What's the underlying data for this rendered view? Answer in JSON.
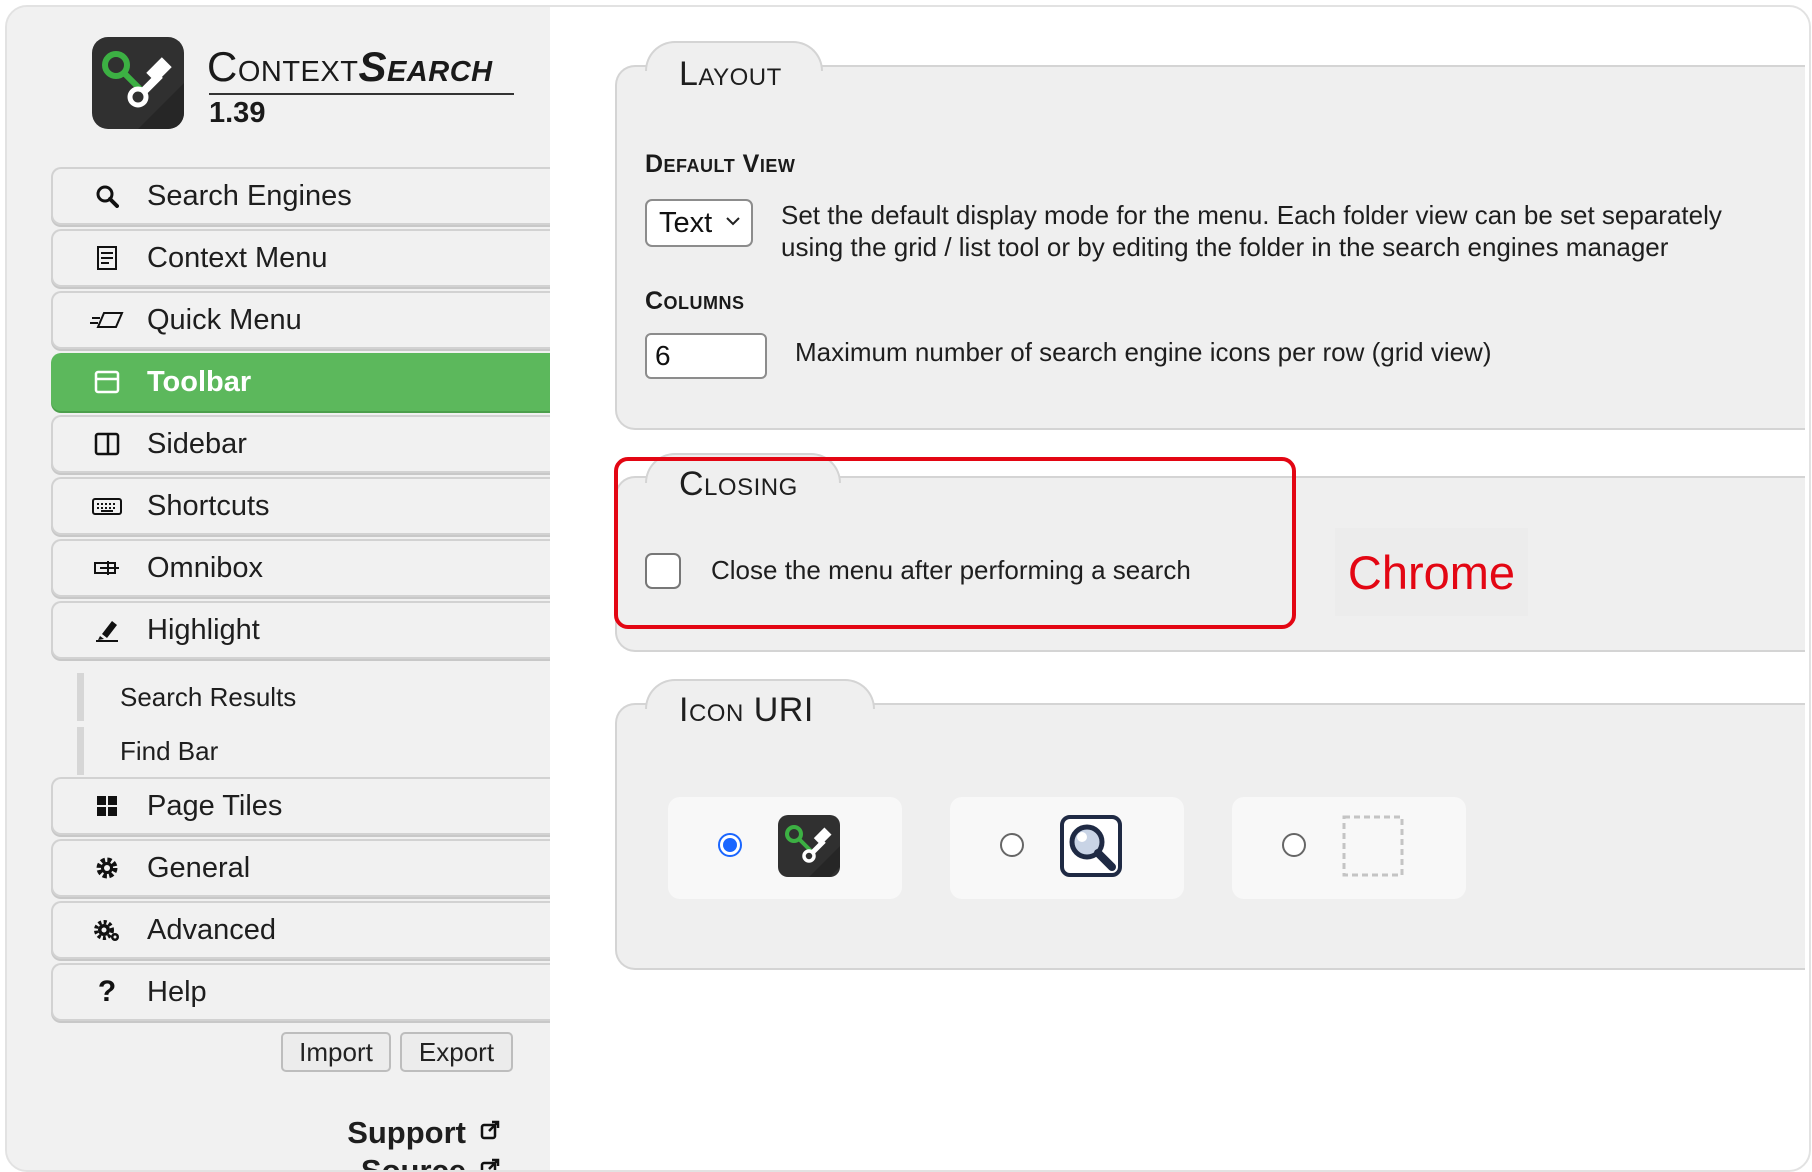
{
  "app": {
    "name_part1": "Context",
    "name_part2": "Search",
    "version": "1.39"
  },
  "nav": {
    "items": [
      {
        "label": "Search Engines",
        "icon": "search-icon"
      },
      {
        "label": "Context Menu",
        "icon": "menu-list-icon"
      },
      {
        "label": "Quick Menu",
        "icon": "quick-menu-icon"
      },
      {
        "label": "Toolbar",
        "icon": "toolbar-icon",
        "active": true
      },
      {
        "label": "Sidebar",
        "icon": "sidebar-icon"
      },
      {
        "label": "Shortcuts",
        "icon": "keyboard-icon"
      },
      {
        "label": "Omnibox",
        "icon": "omnibox-icon"
      },
      {
        "label": "Highlight",
        "icon": "highlighter-icon"
      },
      {
        "label": "Page Tiles",
        "icon": "tiles-icon"
      },
      {
        "label": "General",
        "icon": "gear-icon"
      },
      {
        "label": "Advanced",
        "icon": "gears-icon"
      },
      {
        "label": "Help",
        "icon": "question-icon"
      }
    ],
    "sub_items": [
      "Search Results",
      "Find Bar"
    ],
    "import_label": "Import",
    "export_label": "Export",
    "support_label": "Support",
    "source_label": "Source"
  },
  "layout": {
    "legend": "Layout",
    "default_view_label": "Default View",
    "default_view_value": "Text",
    "default_view_desc_line1": "Set the default display mode for the menu. Each folder view can be set separately",
    "default_view_desc_line2": "using the grid / list tool or by editing the folder in the search engines manager",
    "columns_label": "Columns",
    "columns_value": "6",
    "columns_desc": "Maximum number of search engine icons per row (grid view)"
  },
  "closing": {
    "legend": "Closing",
    "checkbox_label": "Close the menu after performing a search",
    "checked": false
  },
  "browser_tag": "Chrome",
  "icon_uri": {
    "legend": "Icon URI",
    "options": [
      {
        "icon": "contextsearch-logo-icon",
        "selected": true
      },
      {
        "icon": "magnifier-icon",
        "selected": false
      },
      {
        "icon": "blank-icon",
        "selected": false
      }
    ]
  },
  "colors": {
    "active_nav": "#5cb85c",
    "highlight_red": "#e30613",
    "radio_blue": "#1a66ff"
  }
}
